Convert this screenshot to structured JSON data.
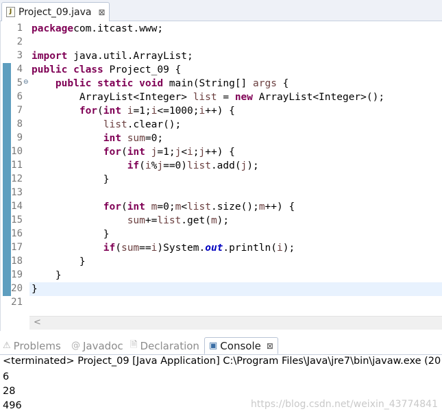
{
  "editor_tab": {
    "label": "Project_09.java",
    "close": "⊠"
  },
  "code": [
    {
      "n": "1",
      "t": [
        [
          "kw",
          "package"
        ],
        [
          "",
          "com.itcast.www;"
        ]
      ]
    },
    {
      "n": "2",
      "t": []
    },
    {
      "n": "3",
      "t": [
        [
          "kw",
          "import"
        ],
        [
          "",
          " java.util.ArrayList;"
        ]
      ]
    },
    {
      "n": "4",
      "t": [
        [
          "kw",
          "public class"
        ],
        [
          "",
          " Project_09 {"
        ]
      ]
    },
    {
      "n": "5",
      "t": [
        [
          "",
          "    "
        ],
        [
          "kw",
          "public static void"
        ],
        [
          "",
          " main(String[] "
        ],
        [
          "var",
          "args"
        ],
        [
          "",
          " {"
        ]
      ],
      "fold": true
    },
    {
      "n": "6",
      "t": [
        [
          "",
          "        ArrayList<Integer> "
        ],
        [
          "var",
          "list"
        ],
        [
          "",
          " = "
        ],
        [
          "kw",
          "new"
        ],
        [
          "",
          " ArrayList<Integer>();"
        ]
      ]
    },
    {
      "n": "7",
      "t": [
        [
          "",
          "        "
        ],
        [
          "kw",
          "for"
        ],
        [
          "",
          "("
        ],
        [
          "kw",
          "int"
        ],
        [
          "",
          " "
        ],
        [
          "var",
          "i"
        ],
        [
          "",
          "=1;"
        ],
        [
          "var",
          "i"
        ],
        [
          "",
          "<=1000;"
        ],
        [
          "var",
          "i"
        ],
        [
          "",
          "++) {"
        ]
      ]
    },
    {
      "n": "8",
      "t": [
        [
          "",
          "            "
        ],
        [
          "var",
          "list"
        ],
        [
          "",
          ".clear();"
        ]
      ]
    },
    {
      "n": "9",
      "t": [
        [
          "",
          "            "
        ],
        [
          "kw",
          "int"
        ],
        [
          "",
          " "
        ],
        [
          "var",
          "sum"
        ],
        [
          "",
          "=0;"
        ]
      ]
    },
    {
      "n": "10",
      "t": [
        [
          "",
          "            "
        ],
        [
          "kw",
          "for"
        ],
        [
          "",
          "("
        ],
        [
          "kw",
          "int"
        ],
        [
          "",
          " "
        ],
        [
          "var",
          "j"
        ],
        [
          "",
          "=1;"
        ],
        [
          "var",
          "j"
        ],
        [
          "",
          "<"
        ],
        [
          "var",
          "i"
        ],
        [
          "",
          ";"
        ],
        [
          "var",
          "j"
        ],
        [
          "",
          "++) {"
        ]
      ]
    },
    {
      "n": "11",
      "t": [
        [
          "",
          "                "
        ],
        [
          "kw",
          "if"
        ],
        [
          "",
          "("
        ],
        [
          "var",
          "i"
        ],
        [
          "",
          "%"
        ],
        [
          "var",
          "j"
        ],
        [
          "",
          "==0)"
        ],
        [
          "var",
          "list"
        ],
        [
          "",
          ".add("
        ],
        [
          "var",
          "j"
        ],
        [
          "",
          ");"
        ]
      ]
    },
    {
      "n": "12",
      "t": [
        [
          "",
          "            }"
        ]
      ]
    },
    {
      "n": "13",
      "t": []
    },
    {
      "n": "14",
      "t": [
        [
          "",
          "            "
        ],
        [
          "kw",
          "for"
        ],
        [
          "",
          "("
        ],
        [
          "kw",
          "int"
        ],
        [
          "",
          " "
        ],
        [
          "var",
          "m"
        ],
        [
          "",
          "=0;"
        ],
        [
          "var",
          "m"
        ],
        [
          "",
          "<"
        ],
        [
          "var",
          "list"
        ],
        [
          "",
          ".size();"
        ],
        [
          "var",
          "m"
        ],
        [
          "",
          "++) {"
        ]
      ]
    },
    {
      "n": "15",
      "t": [
        [
          "",
          "                "
        ],
        [
          "var",
          "sum"
        ],
        [
          "",
          "+="
        ],
        [
          "var",
          "list"
        ],
        [
          "",
          ".get("
        ],
        [
          "var",
          "m"
        ],
        [
          "",
          ");"
        ]
      ]
    },
    {
      "n": "16",
      "t": [
        [
          "",
          "            }"
        ]
      ]
    },
    {
      "n": "17",
      "t": [
        [
          "",
          "            "
        ],
        [
          "kw",
          "if"
        ],
        [
          "",
          "("
        ],
        [
          "var",
          "sum"
        ],
        [
          "",
          "=="
        ],
        [
          "var",
          "i"
        ],
        [
          "",
          ")System."
        ],
        [
          "fld",
          "out"
        ],
        [
          "",
          ".println("
        ],
        [
          "var",
          "i"
        ],
        [
          "",
          ");"
        ]
      ]
    },
    {
      "n": "18",
      "t": [
        [
          "",
          "        }"
        ]
      ]
    },
    {
      "n": "19",
      "t": [
        [
          "",
          "    }"
        ]
      ]
    },
    {
      "n": "20",
      "t": [
        [
          "",
          "}"
        ]
      ]
    },
    {
      "n": "21",
      "t": []
    }
  ],
  "hscroll_arrow": "<",
  "console_tabs": [
    {
      "icon": "⚠",
      "label": "Problems"
    },
    {
      "icon": "@",
      "label": "Javadoc"
    },
    {
      "icon": "🗎",
      "label": "Declaration"
    },
    {
      "icon": "▣",
      "label": "Console",
      "close": "⊠"
    }
  ],
  "console": {
    "status": "<terminated> Project_09 [Java Application] C:\\Program Files\\Java\\jre7\\bin\\javaw.exe (20",
    "output": [
      "6",
      "28",
      "496"
    ],
    "watermark": "https://blog.csdn.net/weixin_43774841"
  }
}
